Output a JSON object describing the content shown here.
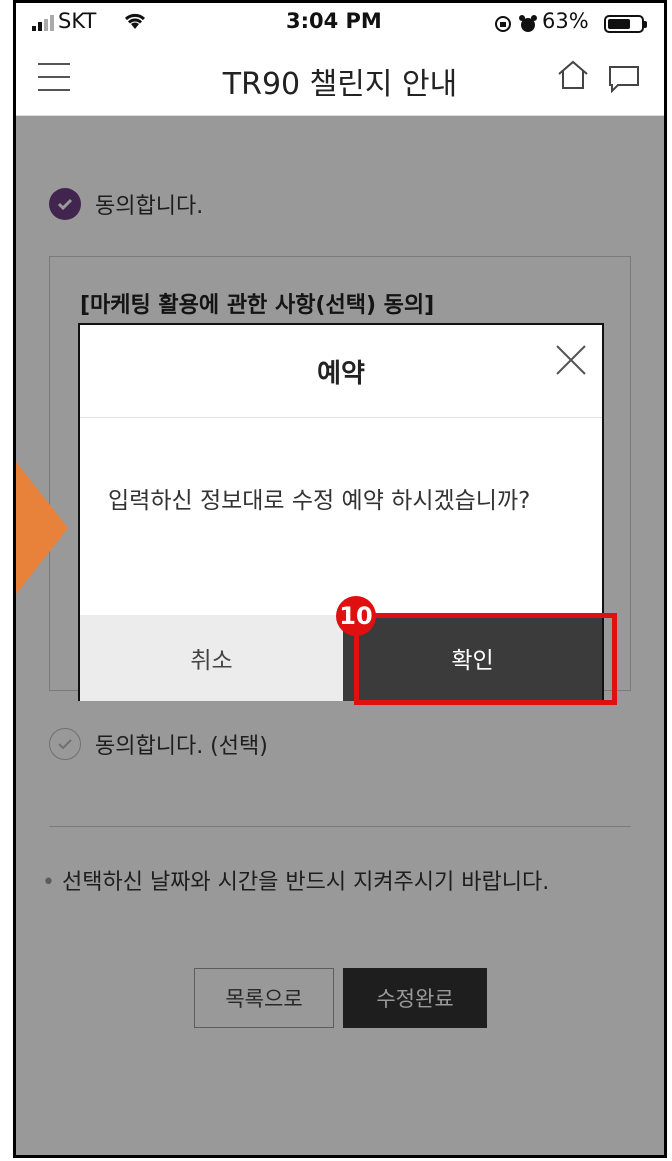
{
  "status_bar": {
    "carrier": "SKT",
    "time": "3:04 PM",
    "battery": "63%"
  },
  "nav": {
    "title": "TR90 챌린지 안내"
  },
  "page": {
    "agree_required": "동의합니다.",
    "terms_title": "[마케팅 활용에 관한 사항(선택) 동의]",
    "agree_optional": "동의합니다. (선택)",
    "notice": "선택하신 날짜와 시간을 반드시 지켜주시기 바랍니다.",
    "notice_bullet": "•",
    "list_button": "목록으로",
    "complete_button": "수정완료"
  },
  "modal": {
    "title": "예약",
    "message": "입력하신 정보대로 수정 예약 하시겠습니까?",
    "cancel_label": "취소",
    "confirm_label": "확인"
  },
  "annotation": {
    "step_number": "10",
    "highlight_color": "#e01010",
    "arrow_color": "#e8823a"
  },
  "colors": {
    "accent_purple": "#6d3f84",
    "dark_button": "#333333"
  }
}
